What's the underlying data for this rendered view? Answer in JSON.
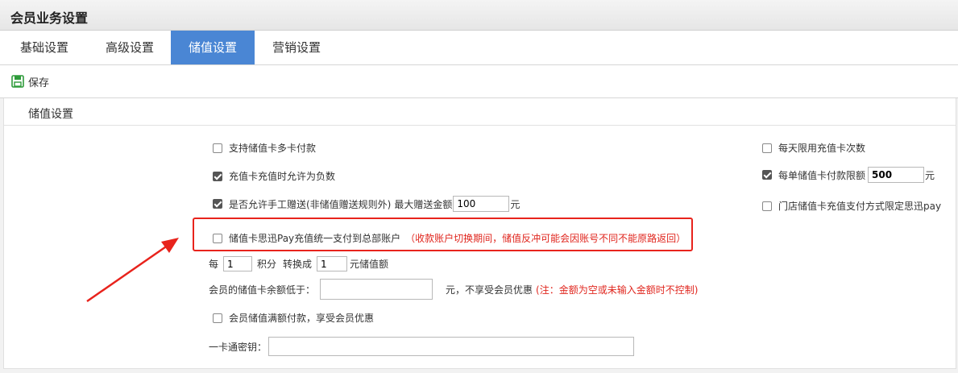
{
  "window": {
    "title": "会员业务设置"
  },
  "tabs": [
    {
      "label": "基础设置",
      "active": false
    },
    {
      "label": "高级设置",
      "active": false
    },
    {
      "label": "储值设置",
      "active": true
    },
    {
      "label": "营销设置",
      "active": false
    }
  ],
  "toolbar": {
    "save_label": "保存",
    "save_icon": "save-icon"
  },
  "section": {
    "title": "储值设置"
  },
  "left_options": {
    "multi_card_pay": {
      "label": "支持储值卡多卡付款",
      "checked": false
    },
    "allow_negative": {
      "label": "充值卡充值时允许为负数",
      "checked": true
    },
    "manual_gift": {
      "label": "是否允许手工赠送(非储值赠送规则外)",
      "checked": true,
      "max_label": "最大赠送金额",
      "max_value": "100",
      "unit": "元"
    },
    "unified_pay": {
      "label": "储值卡思迅Pay充值统一支付到总部账户",
      "note": "（收款账户切换期间，储值反冲可能会因账号不同不能原路返回）",
      "checked": false
    },
    "points": {
      "prefix": "每",
      "points_value": "1",
      "points_label": "积分",
      "convert_label": "转换成",
      "yuan_value": "1",
      "suffix": "元储值额"
    },
    "balance_below": {
      "label": "会员的储值卡余额低于：",
      "value": "",
      "suffix": "元，不享受会员优惠",
      "note": "(注：金额为空或未输入金额时不控制)"
    },
    "full_pay_discount": {
      "label": "会员储值满额付款，享受会员优惠",
      "checked": false
    },
    "card_key": {
      "label": "一卡通密钥：",
      "value": ""
    }
  },
  "right_options": {
    "daily_limit": {
      "label": "每天限用充值卡次数",
      "checked": false
    },
    "per_order_limit": {
      "label": "每单储值卡付款限额",
      "checked": true,
      "value": "500",
      "unit": "元"
    },
    "store_pay_restrict": {
      "label": "门店储值卡充值支付方式限定思迅pay",
      "checked": false
    }
  },
  "annotation": {
    "box_color": "#e8231c",
    "arrow_color": "#e8231c"
  }
}
